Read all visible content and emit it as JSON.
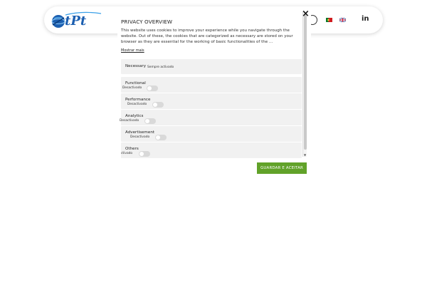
{
  "header": {
    "logo_icon": "tpt-globe-logo",
    "logo_text": "tPt",
    "flags": [
      "pt-flag-icon",
      "en-flag-icon"
    ],
    "linkedin_label": "in"
  },
  "modal": {
    "title": "PRIVACY OVERVIEW",
    "description": "This website uses cookies to improve your experience while you navigate through the website. Out of these, the cookies that are categorized as necessary are stored on your browser as they are essential for the working of basic functionalities of the ...",
    "show_more": "Mostrar mais",
    "close_label": "×",
    "categories": [
      {
        "name": "Necessary",
        "status": "Sempre activado"
      },
      {
        "name": "Functional",
        "status": "Desactivado"
      },
      {
        "name": "Performance",
        "status": "Desactivado"
      },
      {
        "name": "Analytics",
        "status": "Desactivado"
      },
      {
        "name": "Advertisement",
        "status": "Desactivado"
      },
      {
        "name": "Others",
        "status": "ctivado"
      }
    ],
    "accept_label": "GUARDAR E ACEITAR"
  },
  "colors": {
    "accept_green": "#61a229",
    "category_bg": "#f1f1f1",
    "logo_blue": "#2a7fd4"
  }
}
